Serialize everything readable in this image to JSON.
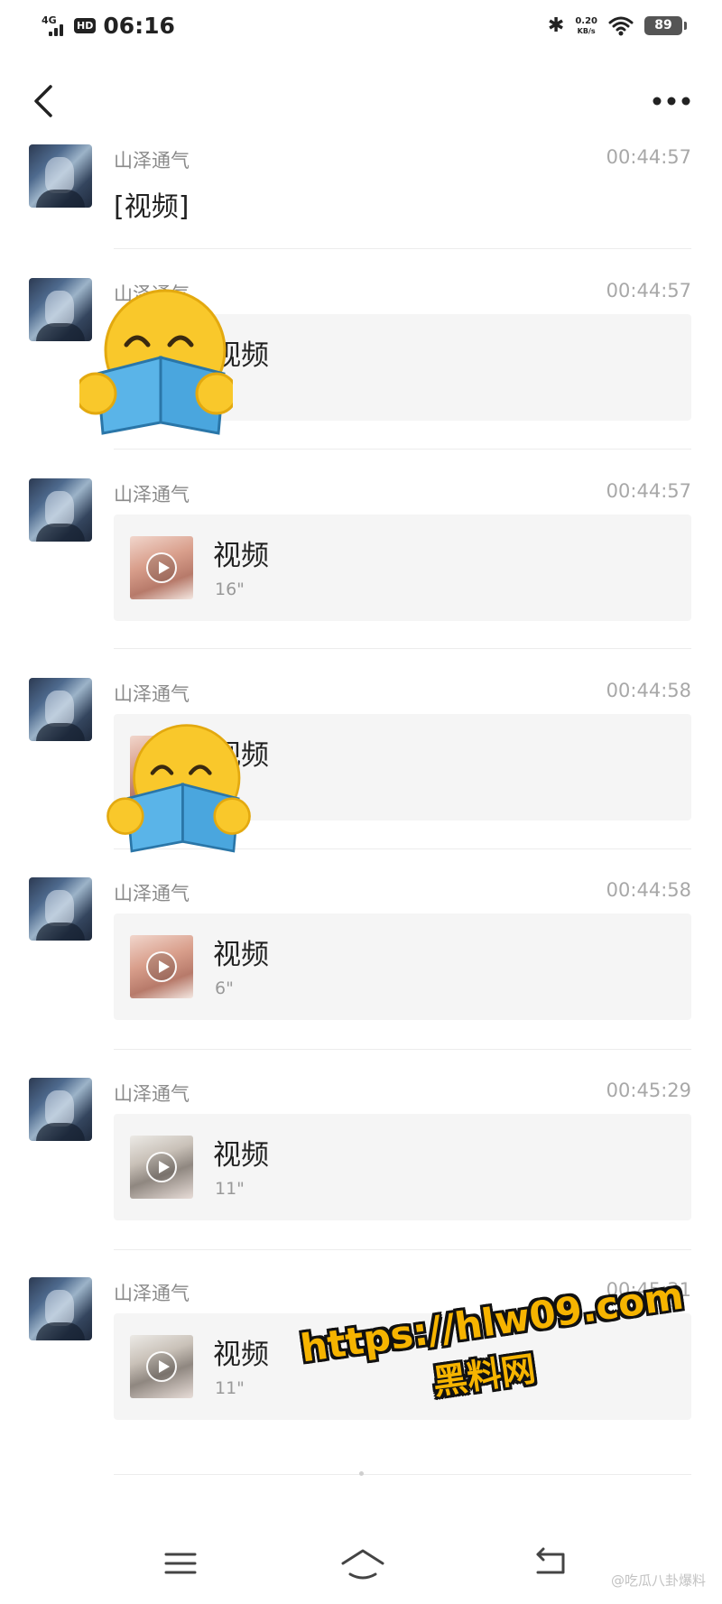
{
  "status_bar": {
    "network": "4G",
    "hd": "HD",
    "time": "06:16",
    "speed_value": "0.20",
    "speed_unit": "KB/s",
    "battery": "89"
  },
  "nav": {
    "back_icon": "chevron-left-icon",
    "more_icon": "more-dots-icon"
  },
  "messages": [
    {
      "sender": "山泽通气",
      "time": "00:44:57",
      "type": "text",
      "text": "[视频]"
    },
    {
      "sender": "山泽通气",
      "time": "00:44:57",
      "type": "video",
      "title": "视频",
      "duration": "0\""
    },
    {
      "sender": "山泽通气",
      "time": "00:44:57",
      "type": "video",
      "title": "视频",
      "duration": "16\""
    },
    {
      "sender": "山泽通气",
      "time": "00:44:58",
      "type": "video",
      "title": "视频",
      "duration": ""
    },
    {
      "sender": "山泽通气",
      "time": "00:44:58",
      "type": "video",
      "title": "视频",
      "duration": "6\""
    },
    {
      "sender": "山泽通气",
      "time": "00:45:29",
      "type": "video",
      "title": "视频",
      "duration": "11\""
    },
    {
      "sender": "山泽通气",
      "time": "00:45:31",
      "type": "video",
      "title": "视频",
      "duration": "11\""
    }
  ],
  "watermark": {
    "url": "https://hlw09.com",
    "name": "黑料网"
  },
  "bottom_nav": {
    "menu_icon": "menu-icon",
    "home_icon": "home-icon",
    "back_icon": "back-icon"
  },
  "credit": "@吃瓜八卦爆料",
  "colors": {
    "card_bg": "#f5f5f5",
    "watermark": "#f6b400",
    "sticker": "#f9c82b"
  }
}
